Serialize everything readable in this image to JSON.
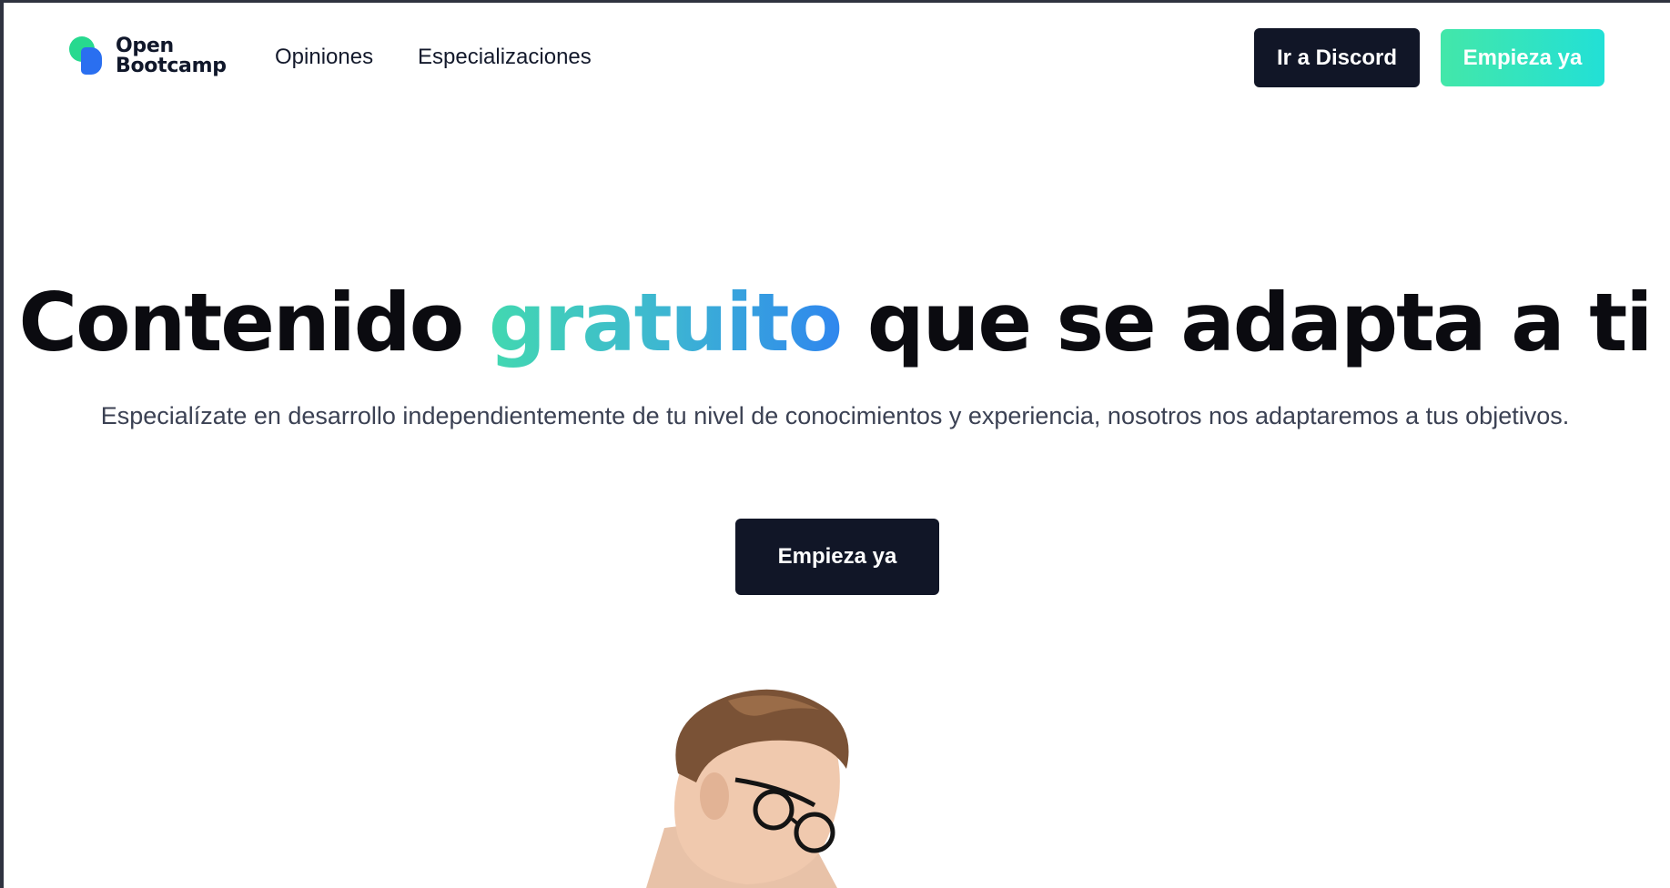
{
  "brand": {
    "name_line1": "Open",
    "name_line2": "Bootcamp",
    "colors": {
      "green": "#27d98f",
      "blue": "#2a6ff0"
    }
  },
  "nav": {
    "links": [
      {
        "label": "Opiniones"
      },
      {
        "label": "Especializaciones"
      }
    ],
    "discord_label": "Ir a Discord",
    "start_label": "Empieza ya"
  },
  "hero": {
    "title_before": "Contenido",
    "title_accent": "gratuito",
    "title_after": "que se adapta a ti",
    "subtitle": "Especialízate en desarrollo independientemente de tu nivel de conocimientos y experiencia, nosotros nos adaptaremos a tus objetivos.",
    "cta_label": "Empieza ya",
    "accent_gradient": [
      "#42d8b0",
      "#3db6d2",
      "#2f86ee"
    ]
  },
  "colors": {
    "dark_button": "#111627",
    "gradient_button": [
      "#43e7a9",
      "#22e0d6"
    ]
  }
}
